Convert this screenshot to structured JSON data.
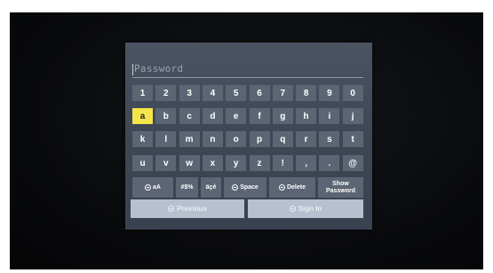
{
  "password_field": {
    "placeholder": "Password",
    "value": ""
  },
  "keyboard": {
    "rows": [
      [
        "1",
        "2",
        "3",
        "4",
        "5",
        "6",
        "7",
        "8",
        "9",
        "0"
      ],
      [
        "a",
        "b",
        "c",
        "d",
        "e",
        "f",
        "g",
        "h",
        "i",
        "j"
      ],
      [
        "k",
        "l",
        "m",
        "n",
        "o",
        "p",
        "q",
        "r",
        "s",
        "t"
      ],
      [
        "u",
        "v",
        "w",
        "x",
        "y",
        "z",
        "!",
        ",",
        ".",
        "@"
      ]
    ],
    "selected_key": "a",
    "function_keys": {
      "case_label": "aA",
      "symbols_label": "#$%",
      "accents_label": "äçé",
      "space_label": "Space",
      "delete_label": "Delete",
      "show_password_label": "Show Password"
    }
  },
  "actions": {
    "previous_label": "Previous",
    "sign_in_label": "Sign In"
  },
  "colors": {
    "key_bg": "#5b6573",
    "selected_key_bg": "#f4e64a",
    "panel_bg": "#3f4856",
    "action_bg": "#b6c0cf"
  }
}
